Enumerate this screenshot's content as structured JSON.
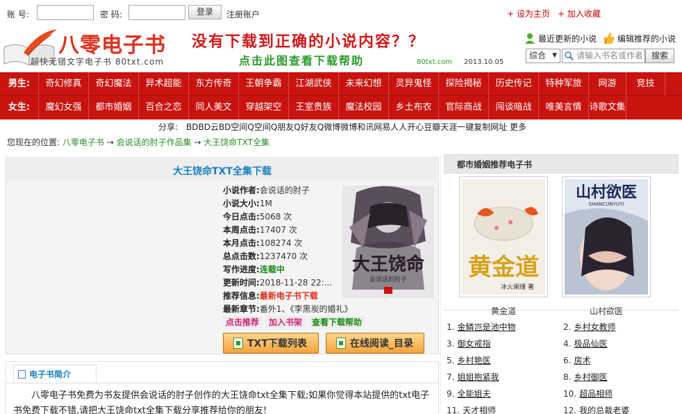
{
  "topbar": {
    "account_label": "账 号:",
    "account_value": "",
    "password_label": "密 码:",
    "password_value": "",
    "login_label": "登录",
    "register_label": "注册账户",
    "set_home_label": "+ 设为主页",
    "add_fav_label": "+ 加入收藏"
  },
  "header": {
    "logo_text": "八零电子书",
    "logo_sub": "超快无错文字电子书 80txt.com",
    "banner_main": "没有下载到正确的小说内容？？",
    "banner_sub": "点击此图查看下载帮助",
    "banner_site": "80txt.com",
    "banner_date": "2013.10.05",
    "latest_label": "最近更新的小说",
    "recommend_label": "编辑推荐的小说",
    "search_select": "综合",
    "search_placeholder": "请输入书名或作者",
    "search_button": "搜索"
  },
  "nav": {
    "row1_head": "男生:",
    "row1": [
      "奇幻修真",
      "奇幻魔法",
      "异术超能",
      "东方传奇",
      "王朝争霸",
      "江湖武侠",
      "未来幻想",
      "灵异鬼怪",
      "探险揭秘",
      "历史传记",
      "特种军旅",
      "网游",
      "竞技"
    ],
    "row2_head": "女生:",
    "row2": [
      "魔幻女强",
      "都市婚姻",
      "百合之恋",
      "同人美文",
      "穿越架空",
      "王室贵族",
      "魔法校园",
      "乡土布衣",
      "官际商战",
      "闯谈暗战",
      "唯美言情",
      "诗歌文集"
    ]
  },
  "share": {
    "label": "分享:",
    "items": "BDBD云BD空间Q空间Q朋友Q好友Q微博微博和讯网易人人开心豆瓣天涯一键复制网址 更多"
  },
  "breadcrumb": {
    "prefix": "您现在的位置:",
    "c1": "八零电子书",
    "arrow1": " → ",
    "c2": "会说话的肘子作品集",
    "arrow2": " → ",
    "c3": "大王饶命TXT全集"
  },
  "book": {
    "title": "大王饶命TXT全集下载",
    "fields": [
      {
        "k": "小说作者:",
        "v": "会说话的肘子",
        "cls": "v"
      },
      {
        "k": "小说大小:",
        "v": "1M",
        "cls": "v"
      },
      {
        "k": "今日点击:",
        "v": "5068 次",
        "cls": "v"
      },
      {
        "k": "本周点击:",
        "v": "17407 次",
        "cls": "v"
      },
      {
        "k": "本月点击:",
        "v": "108274 次",
        "cls": "v"
      },
      {
        "k": "总点击数:",
        "v": "1237470 次",
        "cls": "v"
      },
      {
        "k": "写作进度:",
        "v": "连载中",
        "cls": "v green"
      },
      {
        "k": "更新时间:",
        "v": "2018-11-28 22:...",
        "cls": "v"
      },
      {
        "k": "推荐信息:",
        "v": "最新电子书下载",
        "cls": "v red"
      },
      {
        "k": "最新章节:",
        "v": "番外1、《李黑炭的婚礼》",
        "cls": "v"
      }
    ],
    "tag1": "点击推荐",
    "tag2": "加入书架",
    "tag3": "查看下载帮助",
    "btn_download": "TXT下载列表",
    "btn_read": "在线阅读_目录",
    "cover_title": "大王饶命",
    "cover_author": "会说话的肘子"
  },
  "intro": {
    "tab_label": "电子书简介",
    "text": "八零电子书免费为书友提供会说话的肘子创作的大王饶命txt全集下载;如果你觉得本站提供的txt电子书免费下载不错,请把大王饶命txt全集下载分享推荐给你的朋友!"
  },
  "side": {
    "title": "都市婚姻推荐电子书",
    "book1": "黄金道",
    "book2": "山村欲医",
    "book2_cover_title": "山村欲医",
    "book2_cover_pinyin": "SHANCUNYUYI",
    "book1_cover_author": "冰火阑珊 著",
    "list_left": [
      {
        "n": "1.",
        "t": "金鳞岂是池中物"
      },
      {
        "n": "3.",
        "t": "御女戒指"
      },
      {
        "n": "5.",
        "t": "乡村艳医"
      },
      {
        "n": "7.",
        "t": "姐姐抱紧我"
      },
      {
        "n": "9.",
        "t": "全能姐夫"
      },
      {
        "n": "11.",
        "t": "天才相师"
      }
    ],
    "list_right": [
      {
        "n": "2.",
        "t": "乡村女教师"
      },
      {
        "n": "4.",
        "t": "极品仙医"
      },
      {
        "n": "6.",
        "t": "房术"
      },
      {
        "n": "8.",
        "t": "乡村御医"
      },
      {
        "n": "10.",
        "t": "超品相师"
      },
      {
        "n": "12.",
        "t": "我的总裁老婆"
      }
    ]
  },
  "colors": {
    "nav_red": "#c8130f",
    "logo_red": "#e0301e",
    "link_green": "#2a8a2a",
    "title_blue": "#1a7fc0"
  }
}
